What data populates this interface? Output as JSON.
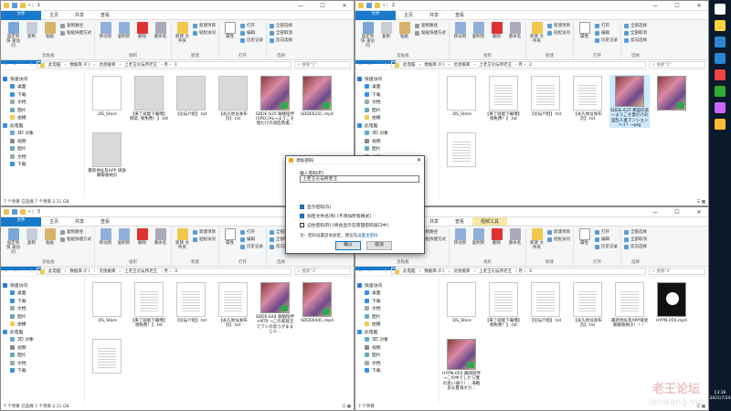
{
  "common": {
    "tabs": [
      "文件",
      "主页",
      "共享",
      "查看"
    ],
    "ribbon": {
      "pin": "固定到快\n速访问",
      "copy": "复制",
      "paste": "粘贴",
      "copy_path": "复制路径",
      "paste_shortcut": "粘贴快捷方式",
      "clipboard": "剪贴板",
      "move_to": "移动到",
      "copy_to": "复制到",
      "delete": "删除",
      "rename": "重命名",
      "organize": "组织",
      "new_folder": "新建\n文件夹",
      "new_item": "新建项目",
      "easy_access": "轻松访问",
      "new": "新建",
      "properties": "属性",
      "open": "打开",
      "edit": "编辑",
      "history": "历史记录",
      "open_group": "打开",
      "select_all": "全部选择",
      "select_none": "全部取消",
      "invert": "反向选择",
      "select": "选择"
    },
    "nav": {
      "quick_access": "快速访问",
      "desktop": "桌面",
      "downloads": "下载",
      "documents": "文档",
      "pictures": "图片",
      "chuanbo": "由播",
      "this_pc": "此电脑",
      "objects3d": "3D 对象",
      "videos": "视频",
      "pictures2": "图片",
      "documents2": "文档",
      "downloads2": "下载"
    },
    "path": [
      "此电脑",
      "数据库 (F:)",
      "灵盘援库",
      "上老王论坛所老王"
    ]
  },
  "windows": {
    "w1": {
      "folder": "1",
      "search": "搜索\"1\"",
      "files": [
        {
          "name": ".DS_Store",
          "kind": "blank"
        },
        {
          "name": "【来了就能下载哦】纲常, 纲免费！】.txt",
          "kind": "blank-grey"
        },
        {
          "name": "【论坛介绍】.txt",
          "kind": "blank-grey"
        },
        {
          "name": "【永久地址发布页】.txt",
          "kind": "blank-grey"
        },
        {
          "name": "SDDE-625 跟随陪伴 [SPECIAL→ようこそ僕だけの浪乱熟妻…",
          "kind": "vid"
        },
        {
          "name": "SDDE625C.mp4",
          "kind": "vid"
        },
        {
          "name": "最新地址及APP 请放聊聊收纳页",
          "kind": "blank-grey"
        }
      ],
      "status": "7 个项目  已选择 7 个项目  2.11 GB"
    },
    "w2": {
      "folder": "2",
      "search": "搜索\"2\"",
      "files": [
        {
          "name": ".DS_Store",
          "kind": "blank"
        },
        {
          "name": "【来了就能下载哦】纲免费！】.txt",
          "kind": "doc"
        },
        {
          "name": "【论坛介绍】.txt",
          "kind": "doc"
        },
        {
          "name": "【永久地址发布页】.txt",
          "kind": "doc"
        },
        {
          "name": "SDDE-637 那里的洗ーようこそ僕だけの淫乱人妻マンションへイ！→ptg",
          "kind": "vid-sel"
        },
        {
          "name": "",
          "kind": "vid"
        },
        {
          "name": "",
          "kind": "doc"
        }
      ],
      "status": "7 个项目"
    },
    "w3": {
      "folder": "3",
      "search": "搜索\"3\"",
      "files": [
        {
          "name": ".DS_Store",
          "kind": "blank"
        },
        {
          "name": "【来了就能下载哦】纲免费！】.txt",
          "kind": "doc"
        },
        {
          "name": "【论坛介绍】.txt",
          "kind": "doc"
        },
        {
          "name": "【永久地址发布页】.txt",
          "kind": "doc"
        },
        {
          "name": "SDDE-644 跟随陪伴 +NTR →この家族全てワシの思うがままじゃ…",
          "kind": "vid"
        },
        {
          "name": "SDDE644C.mp4",
          "kind": "vid"
        },
        {
          "name": "",
          "kind": "doc"
        }
      ],
      "status": "7 个项目  已选择 7 个项目  2.11 GB"
    },
    "w4": {
      "folder": "4",
      "search": "搜索\"4\"",
      "context_tab": "视频工具",
      "files": [
        {
          "name": ".DS_Store",
          "kind": "blank"
        },
        {
          "name": "【来了就能下载哦】纲免费！】.txt",
          "kind": "doc"
        },
        {
          "name": "【论坛介绍】.txt",
          "kind": "doc"
        },
        {
          "name": "【永久地址发布页】.txt",
          "kind": "doc"
        },
        {
          "name": "最新地址及APP请放聊聊收纳页！！！",
          "kind": "doc"
        },
        {
          "name": "HYPN-050.mp4",
          "kind": "vid-dark"
        },
        {
          "name": "HYPN-050 跟随陪伴→この中でしたら僕の思い通り！…海戦多な豊満ボカ…",
          "kind": "vid"
        }
      ],
      "status": "7 个项目"
    }
  },
  "dialog": {
    "title": "添加密码",
    "input_label": "输入密码(E)",
    "input_value": "上老王论坛所老王",
    "opt1": "显示密码(S)",
    "opt2": "加密文件名(N) (不添加所有模式)",
    "opt3": "记住密码(R) (将会显示在管理密码窗口中)",
    "note": "注：密码设置后会加密，建议先",
    "note_link": "设置主密码",
    "ok": "确认",
    "cancel": "取消"
  },
  "taskbar": {
    "time": "13:36",
    "date": "2021/7/24"
  },
  "watermark": {
    "line1": "老王论坛",
    "line2": "laowang.vip"
  }
}
